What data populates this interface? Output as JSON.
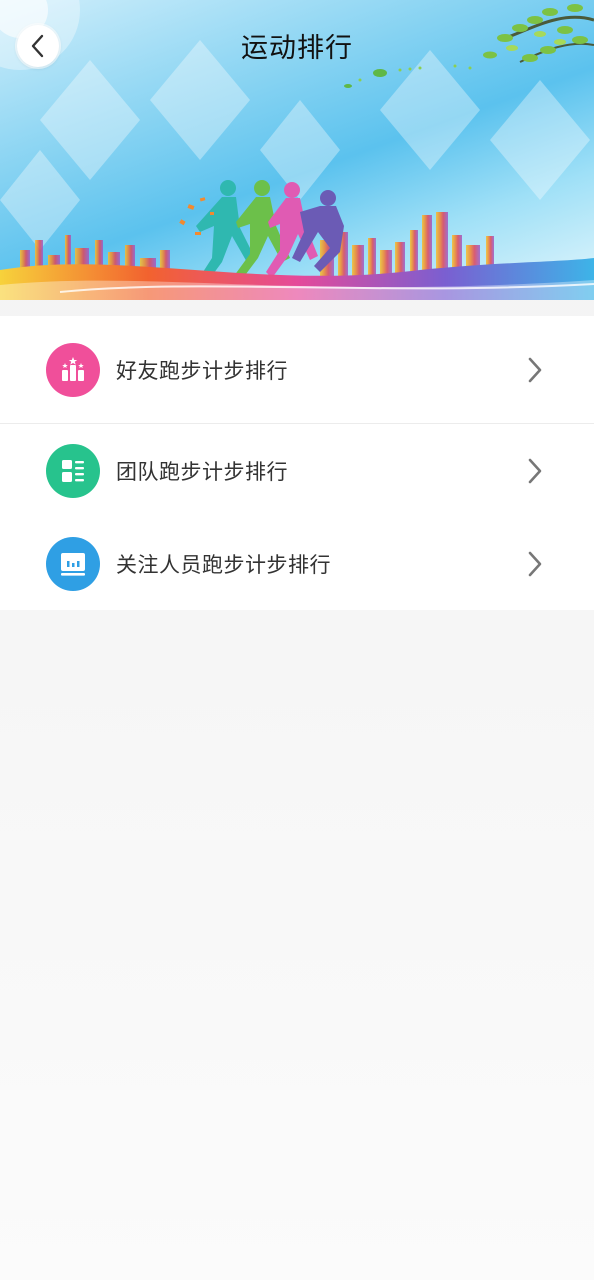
{
  "header": {
    "title": "运动排行",
    "back_icon": "chevron-left-icon"
  },
  "menu": {
    "items": [
      {
        "label": "好友跑步计步排行",
        "icon": "podium-icon",
        "icon_color": "#f04f9a"
      },
      {
        "label": "团队跑步计步排行",
        "icon": "layout-list-icon",
        "icon_color": "#27c38d"
      },
      {
        "label": "关注人员跑步计步排行",
        "icon": "chart-board-icon",
        "icon_color": "#2f9fe4"
      }
    ],
    "arrow_icon": "chevron-right-icon"
  },
  "colors": {
    "page_background": "#f3f4f4",
    "list_background": "#ffffff",
    "text": "#333333"
  }
}
